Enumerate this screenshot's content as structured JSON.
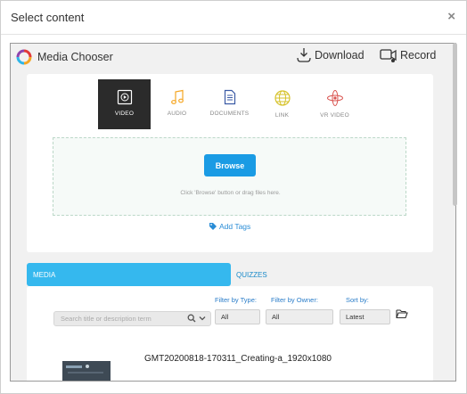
{
  "dialog": {
    "title": "Select content",
    "close_glyph": "×"
  },
  "chooser": {
    "brand": "Media Chooser",
    "actions": {
      "download_label": "Download",
      "record_label": "Record"
    },
    "types": [
      {
        "label": "VIDEO",
        "icon": "video-icon",
        "active": true
      },
      {
        "label": "AUDIO",
        "icon": "music-note-icon",
        "active": false
      },
      {
        "label": "DOCUMENTS",
        "icon": "document-icon",
        "active": false
      },
      {
        "label": "LINK",
        "icon": "globe-icon",
        "active": false
      },
      {
        "label": "VR VIDEO",
        "icon": "vr-atom-icon",
        "active": false
      }
    ],
    "browse_label": "Browse",
    "drop_hint": "Click 'Browse' button or drag files here.",
    "add_tags_label": "Add Tags"
  },
  "tabs": {
    "media_label": "MEDIA",
    "quizzes_label": "QUIZZES",
    "active": "MEDIA"
  },
  "filters": {
    "search_placeholder": "Search title or description term",
    "type_label": "Filter by Type:",
    "type_value": "All",
    "owner_label": "Filter by Owner:",
    "owner_value": "All",
    "sort_label": "Sort by:",
    "sort_value": "Latest"
  },
  "items": [
    {
      "title": "GMT20200818-170311_Creating-a_1920x1080"
    }
  ],
  "colors": {
    "primary_blue": "#1a9be4",
    "tab_blue": "#35b8ee",
    "link_blue": "#2a8dd6",
    "active_type_bg": "#2b2b2b"
  }
}
